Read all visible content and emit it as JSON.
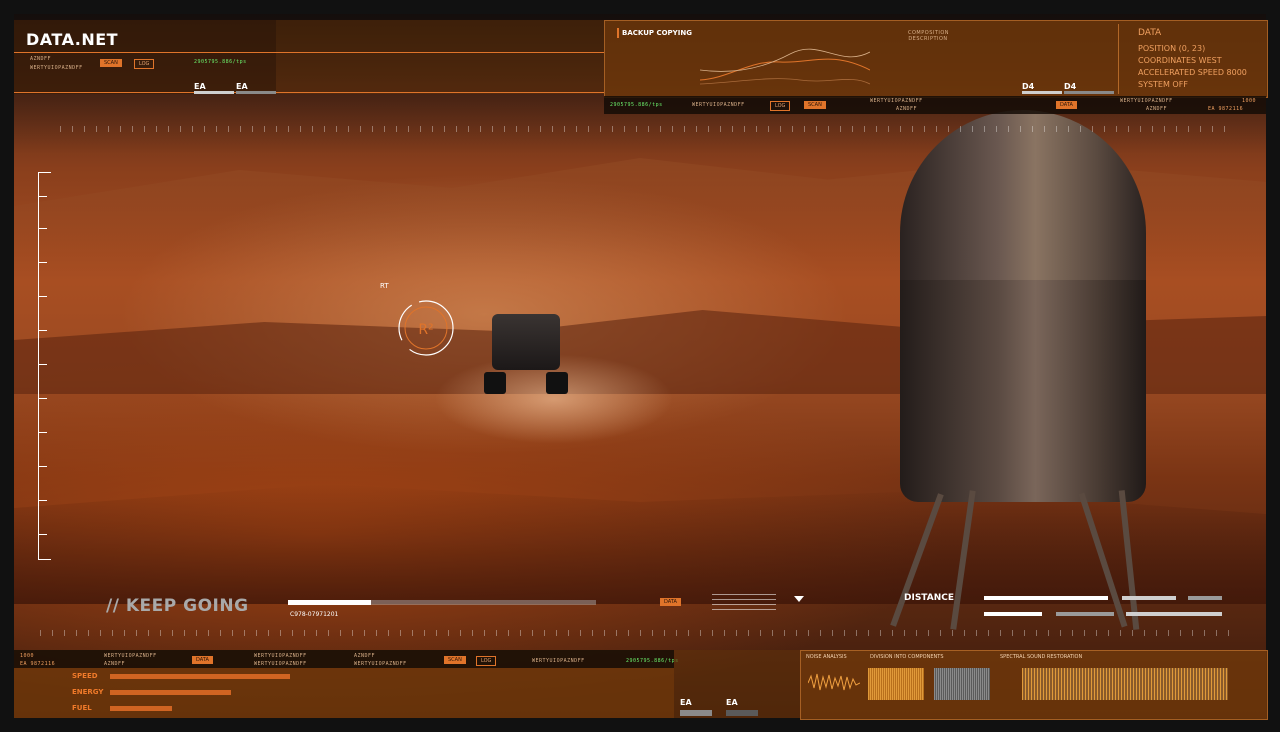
{
  "app": {
    "title": "DATA.NET"
  },
  "top_left": {
    "code_a": "AZNDFF",
    "code_b": "WERTYUIOPAZNDFF",
    "btn_scan": "SCAN",
    "btn_log": "LOG",
    "rate": "2905795.886/tps"
  },
  "ea_labels": {
    "a": "EA",
    "b": "EA"
  },
  "backup": {
    "title": "BACKUP COPYING",
    "right_title": "COMPOSITION DESCRIPTION",
    "footer_rate": "2905795.886/tps",
    "footer_code": "WERTYUIOPAZNDFF",
    "btn_log": "LOG",
    "btn_scan": "SCAN",
    "sub_code_a": "WERTYUIOPAZNDFF",
    "sub_code_b": "AZNDFF",
    "btn_data": "DATA",
    "sub_code_c": "WERTYUIOPAZNDFF",
    "sub_code_d": "AZNDFF"
  },
  "d4": {
    "a": "D4",
    "b": "D4"
  },
  "data_panel": {
    "title": "DATA",
    "lines": [
      "POSITION  (0,  23)",
      "COORDINATES WEST",
      "ACCELERATED SPEED  8000",
      "SYSTEM OFF"
    ],
    "num_a": "1000",
    "num_b": "EA  9872116"
  },
  "target": {
    "label": "RT",
    "symbol": "R²"
  },
  "hud": {
    "keep_going": "// KEEP GOING",
    "code": "C978-07971201",
    "progress": 0.27,
    "btn_data": "DATA",
    "distance": "DISTANCE"
  },
  "bottom": {
    "num_a": "1000",
    "num_b": "EA  9872116",
    "code_a": "WERTYUIOPAZNDFF",
    "code_b": "AZNDFF",
    "btn_data": "DATA",
    "code_c": "WERTYUIOPAZNDFF",
    "code_d": "WERTYUIOPAZNDFF",
    "code_e": "AZNDFF",
    "btn_scan": "SCAN",
    "btn_log": "LOG",
    "code_f": "WERTYUIOPAZNDFF",
    "rate": "2905795.886/tps",
    "stats": [
      {
        "label": "SPEED",
        "level": 0.58
      },
      {
        "label": "ENERGY",
        "level": 0.39
      },
      {
        "label": "FUEL",
        "level": 0.2
      }
    ],
    "ea_a": "EA",
    "ea_b": "EA",
    "noise": "NOISE ANALYSIS",
    "division": "DIVISION INTO COMPONENTS",
    "spectral": "SPECTRAL SOUND RESTORATION"
  },
  "colors": {
    "accent": "#e0742a",
    "panel": "#7a3c0a",
    "text_orange": "#f0a060"
  }
}
